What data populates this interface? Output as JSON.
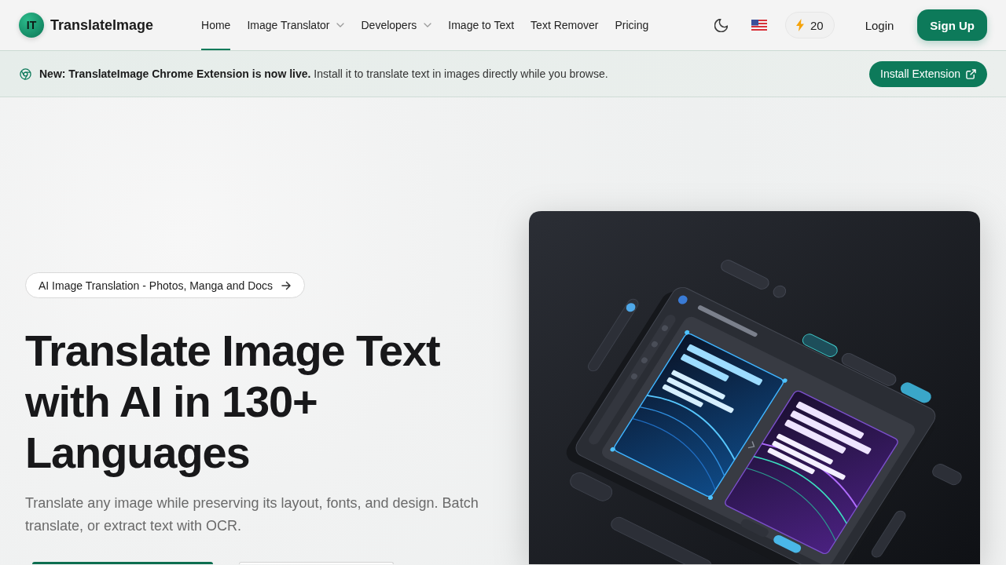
{
  "brand": {
    "logo": "IT",
    "name": "TranslateImage"
  },
  "nav": [
    {
      "label": "Home",
      "selected": true,
      "has_menu": false
    },
    {
      "label": "Image Translator",
      "selected": false,
      "has_menu": true
    },
    {
      "label": "Developers",
      "selected": false,
      "has_menu": true
    },
    {
      "label": "Image to Text",
      "selected": false,
      "has_menu": false
    },
    {
      "label": "Text Remover",
      "selected": false,
      "has_menu": false
    },
    {
      "label": "Pricing",
      "selected": false,
      "has_menu": false
    }
  ],
  "header_actions": {
    "credits": "20",
    "login": "Login",
    "signup": "Sign Up"
  },
  "announcement": {
    "message": "**New: TranslateImage Chrome Extension is now live.** Install it to translate text in images directly while you browse.",
    "button": "Install Extension"
  },
  "hero": {
    "badge": "AI Image Translation - Photos, Manga and Docs",
    "heading": "Translate Image Text with AI in 130+ Languages",
    "description": "Translate any image while preserving its layout, fonts, and design. Batch translate, or extract text with OCR."
  }
}
